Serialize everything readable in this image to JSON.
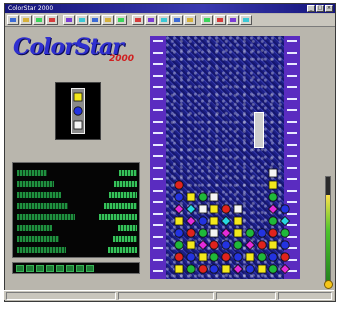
{
  "window": {
    "title": "ColorStar 2000",
    "buttons": [
      "_",
      "□",
      "×"
    ]
  },
  "logo": {
    "main": "ColorStar",
    "sub": "2000"
  },
  "toolbar": {
    "icons": [
      "new-game-icon",
      "open-icon",
      "save-icon",
      "pause-icon",
      "sound-icon",
      "music-icon",
      "options-icon",
      "scores-icon",
      "level-icon",
      "theme-icon",
      "speed-icon",
      "grid-icon",
      "star-icon",
      "trophy-icon",
      "lightbulb-icon",
      "help-icon",
      "about-icon",
      "exit-icon"
    ]
  },
  "colors": {
    "red": "#e0231d",
    "blue": "#2333e0",
    "yellow": "#f3e81c",
    "green": "#1fb83a",
    "magenta": "#e32bd9",
    "cyan": "#27d6e0",
    "white": "#f4f4f4",
    "orange": "#ff8a1a"
  },
  "preview": {
    "gems": [
      "yellow",
      "blue",
      "white"
    ]
  },
  "stats": {
    "rows": 8
  },
  "meter": {
    "level": 0.83
  },
  "board": {
    "columns": 10,
    "rows": 9,
    "cells": [
      [
        "",
        "",
        "",
        "",
        "",
        "",
        "",
        "",
        "white",
        ""
      ],
      [
        "red",
        "",
        "",
        "",
        "",
        "",
        "",
        "",
        "yellow",
        ""
      ],
      [
        "blue",
        "yellow",
        "green",
        "white",
        "",
        "",
        "",
        "",
        "green",
        ""
      ],
      [
        "magenta",
        "cyan",
        "white",
        "yellow",
        "red",
        "white",
        "",
        "",
        "magenta",
        "blue"
      ],
      [
        "yellow",
        "magenta",
        "blue",
        "yellow",
        "cyan",
        "yellow",
        "",
        "",
        "green",
        "cyan"
      ],
      [
        "blue",
        "red",
        "green",
        "white",
        "magenta",
        "yellow",
        "green",
        "blue",
        "red",
        "green"
      ],
      [
        "green",
        "yellow",
        "magenta",
        "red",
        "blue",
        "green",
        "magenta",
        "red",
        "yellow",
        "blue"
      ],
      [
        "red",
        "blue",
        "yellow",
        "green",
        "red",
        "blue",
        "yellow",
        "green",
        "blue",
        "red"
      ],
      [
        "yellow",
        "green",
        "red",
        "blue",
        "yellow",
        "magenta",
        "blue",
        "yellow",
        "green",
        "magenta"
      ]
    ]
  }
}
